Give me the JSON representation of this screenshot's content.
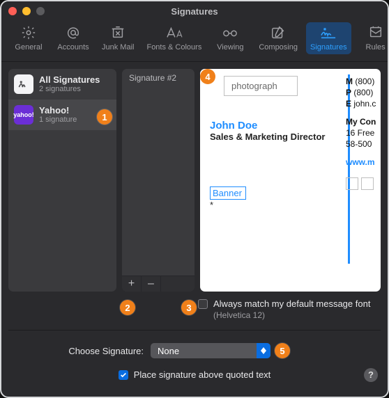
{
  "window": {
    "title": "Signatures"
  },
  "tabs": {
    "general": "General",
    "accounts": "Accounts",
    "junk": "Junk Mail",
    "fonts": "Fonts & Colours",
    "viewing": "Viewing",
    "composing": "Composing",
    "signatures": "Signatures",
    "rules": "Rules"
  },
  "accountsList": {
    "all": {
      "title": "All Signatures",
      "sub": "2 signatures"
    },
    "yahoo": {
      "title": "Yahoo!",
      "sub": "1 signature",
      "glyph": "yahoo!"
    }
  },
  "sigList": {
    "item0": "Signature #2"
  },
  "tools": {
    "add": "+",
    "remove": "–"
  },
  "preview": {
    "photo": "photograph",
    "name": "John Doe",
    "role": "Sales & Marketing Director",
    "mLabel": "M",
    "mVal": " (800)",
    "pLabel": "P",
    "pVal": " (800)",
    "eLabel": "E",
    "eVal": " john.c",
    "company": "My Con",
    "addr1": "16 Free",
    "addr2": "58-500",
    "site": "www.m",
    "banner": "Banner",
    "star": "*"
  },
  "matchFont": {
    "label": "Always match my default message font",
    "hint": "(Helvetica 12)"
  },
  "choose": {
    "label": "Choose Signature:",
    "value": "None"
  },
  "place": {
    "label": "Place signature above quoted text"
  },
  "badges": {
    "b1": "1",
    "b2": "2",
    "b3": "3",
    "b4": "4",
    "b5": "5"
  },
  "help": "?"
}
